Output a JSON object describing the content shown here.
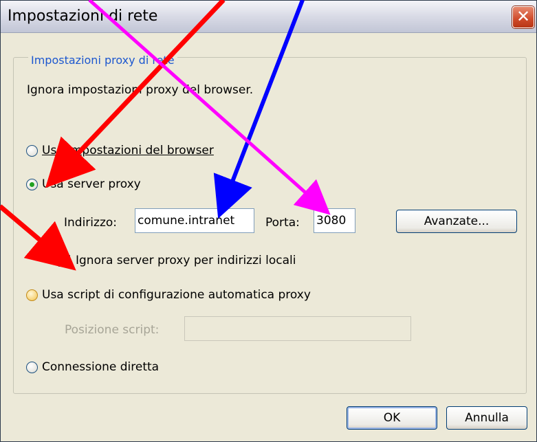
{
  "window": {
    "title": "Impostazioni di rete",
    "close_glyph": "✕"
  },
  "group": {
    "legend": "Impostazioni proxy di rete",
    "description": "Ignora impostazioni proxy del browser."
  },
  "options": {
    "browser": {
      "label": "Usa impostazioni del browser",
      "selected": false
    },
    "server_proxy": {
      "label": "Usa server proxy",
      "selected": true
    },
    "auto_script": {
      "label": "Usa script di configurazione automatica proxy",
      "selected": false
    },
    "direct": {
      "label": "Connessione diretta",
      "selected": false
    }
  },
  "proxy": {
    "address_label": "Indirizzo:",
    "address_value": "comune.intranet",
    "port_label": "Porta:",
    "port_value": "3080",
    "advanced_button": "Avanzate...",
    "bypass_local_label": "Ignora server proxy per indirizzi locali",
    "bypass_local_checked": true
  },
  "script": {
    "location_label": "Posizione script:",
    "location_value": ""
  },
  "buttons": {
    "ok": "OK",
    "cancel": "Annulla"
  },
  "annotations": {
    "arrow_colors": [
      "#ff0000",
      "#0000ff",
      "#ff00ff"
    ]
  }
}
